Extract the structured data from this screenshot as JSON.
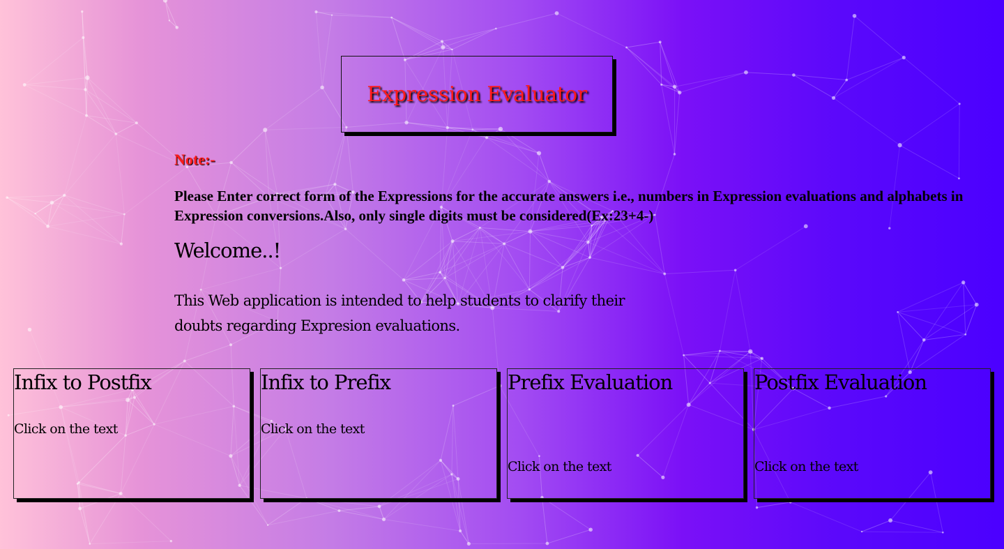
{
  "header": {
    "title": "Expression Evaluator"
  },
  "note": {
    "label": "Note:-",
    "text": "Please Enter correct form of the Expressions for the accurate answers i.e., numbers in Expression evaluations and alphabets in Expression conversions.Also, only single digits must be considered(Ex:23+4-)"
  },
  "welcome": {
    "heading": "Welcome..!",
    "intro": "This Web application is intended to help students to clarify their doubts regarding Expresion evaluations."
  },
  "cards": [
    {
      "title": "Infix to Postfix",
      "link": "Click on the text"
    },
    {
      "title": "Infix to Prefix",
      "link": "Click on the text"
    },
    {
      "title": "Prefix Evaluation",
      "link": "Click on the text"
    },
    {
      "title": "Postfix Evaluation",
      "link": "Click on the text"
    }
  ],
  "colors": {
    "title": "#ff1a1a",
    "background_start": "#ffc2d9",
    "background_end": "#4b00ff"
  }
}
